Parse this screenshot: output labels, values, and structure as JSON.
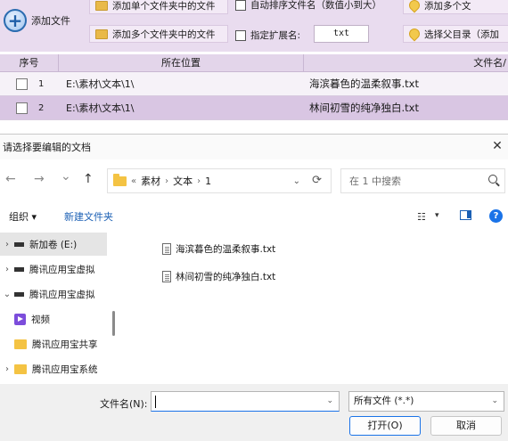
{
  "app": {
    "add_file_label": "添加文件",
    "add_single_folder": "添加单个文件夹中的文件",
    "add_multi_folders": "添加多个文件夹中的文件",
    "auto_sort_label": "自动排序文件名（数值小到大）",
    "ext_label": "指定扩展名:",
    "ext_value": "txt",
    "add_multi_trunc": "添加多个文",
    "select_parent_dir": "选择父目录（添加"
  },
  "table": {
    "headers": [
      "序号",
      "所在位置",
      "文件名/"
    ],
    "rows": [
      {
        "no": "1",
        "location": "E:\\素材\\文本\\1\\",
        "name": "海滨暮色的温柔叙事.txt"
      },
      {
        "no": "2",
        "location": "E:\\素材\\文本\\1\\",
        "name": "林间初雪的纯净独白.txt"
      }
    ]
  },
  "dialog": {
    "title": "请选择要编辑的文档",
    "close_glyph": "✕",
    "nav": {
      "back": "←",
      "forward": "→",
      "recent": "⌄",
      "up": "↑"
    },
    "breadcrumb": {
      "overflow": "«",
      "items": [
        "素材",
        "文本",
        "1"
      ],
      "sep": "›"
    },
    "refresh_glyph": "⟳",
    "dropdown_glyph": "⌄",
    "search_placeholder": "在 1 中搜索",
    "organize": "组织 ▾",
    "new_folder": "新建文件夹",
    "view_glyph": "☷",
    "view_dd": "▾",
    "help": "?",
    "tree": [
      {
        "chev": "›",
        "label": "新加卷 (E:)",
        "icon": "drive-icon",
        "selected": true
      },
      {
        "chev": "›",
        "label": "腾讯应用宝虚拟",
        "icon": "drive-icon",
        "selected": false
      },
      {
        "chev": "⌄",
        "label": "腾讯应用宝虚拟",
        "icon": "drive-icon",
        "selected": false
      },
      {
        "chev": "",
        "label": "视频",
        "icon": "video-icon",
        "selected": false
      },
      {
        "chev": "",
        "label": "腾讯应用宝共享",
        "icon": "folder-icon",
        "selected": false
      },
      {
        "chev": "›",
        "label": "腾讯应用宝系统",
        "icon": "folder-icon",
        "selected": false
      }
    ],
    "files": [
      "海滨暮色的温柔叙事.txt",
      "林间初雪的纯净独白.txt"
    ],
    "filename_label": "文件名(N):",
    "filename_value": "",
    "filetype_value": "所有文件 (*.*)",
    "open_label": "打开(O)",
    "cancel_label": "取消"
  },
  "colors": {
    "accent": "#1a73e8",
    "app_bg": "#e9dcef",
    "row_selected": "#d9c6e3"
  }
}
